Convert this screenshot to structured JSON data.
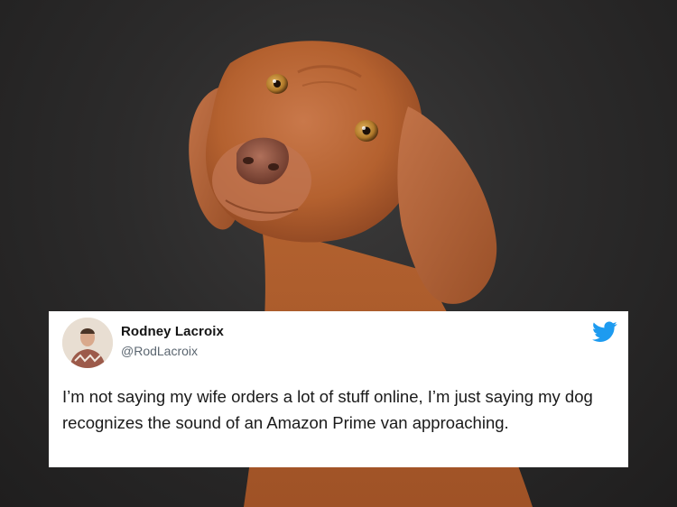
{
  "tweet": {
    "author_name": "Rodney Lacroix",
    "author_handle": "@RodLacroix",
    "text": "I’m not saying my wife orders a lot of stuff online, I’m just saying my dog recognizes the sound of an Amazon Prime van approaching."
  },
  "icons": {
    "brand": "twitter-bird-icon",
    "avatar": "profile-photo"
  },
  "colors": {
    "twitter_blue": "#1d9bf0",
    "background": "#2b2a2a",
    "dog_fur": "#b8643a"
  }
}
